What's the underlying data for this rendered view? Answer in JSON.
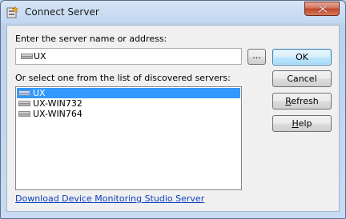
{
  "window": {
    "title": "Connect Server",
    "close_icon": "close-x-icon",
    "app_icon": "connect-server-icon"
  },
  "form": {
    "address_label": "Enter the server name or address:",
    "address_value": "UX",
    "browse_label": "...",
    "list_label": "Or select one from the list of discovered servers:",
    "servers": [
      {
        "label": "UX",
        "selected": true
      },
      {
        "label": "UX-WIN732",
        "selected": false
      },
      {
        "label": "UX-WIN764",
        "selected": false
      }
    ],
    "download_link": "Download Device Monitoring Studio Server"
  },
  "buttons": {
    "ok": "OK",
    "cancel": "Cancel",
    "refresh_accel": "R",
    "refresh_rest": "efresh",
    "help_accel": "H",
    "help_rest": "elp"
  },
  "colors": {
    "selection": "#3399ff",
    "link": "#0b3fbf",
    "close_button": "#c0432b"
  }
}
